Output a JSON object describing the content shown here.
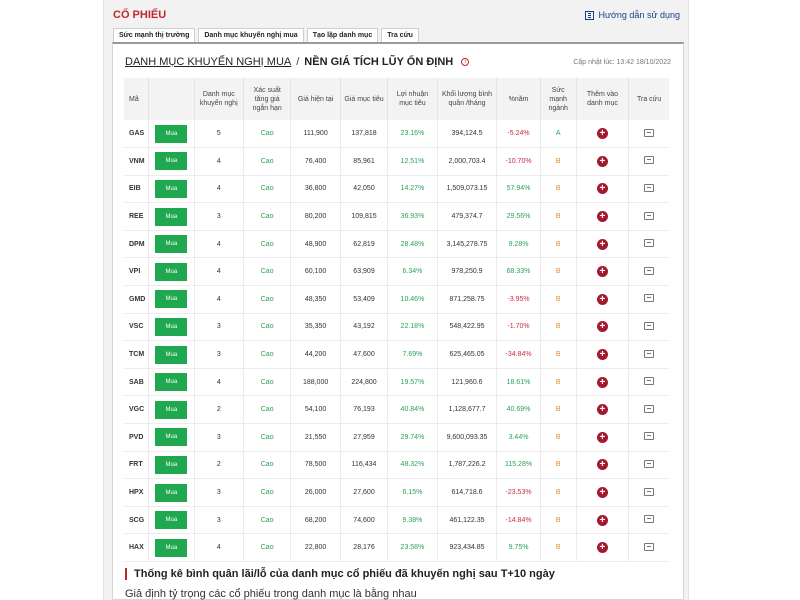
{
  "header": {
    "title": "CỔ PHIẾU",
    "guide_label": "Hướng dẫn sử dụng"
  },
  "tabs": [
    {
      "label": "Sức mạnh thị trường"
    },
    {
      "label": "Danh mục khuyến nghị mua"
    },
    {
      "label": "Tạo lập danh mục"
    },
    {
      "label": "Tra cứu"
    }
  ],
  "breadcrumb": {
    "parent": "DANH MỤC KHUYẾN NGHỊ MUA",
    "separator": "/",
    "current": "NỀN GIÁ TÍCH LŨY ỔN ĐỊNH",
    "info_icon": "i"
  },
  "updated": "Cập nhật lúc: 13:42 18/10/2022",
  "table": {
    "columns": [
      "Mã",
      "",
      "Danh mục khuyến nghị",
      "Xác suất tăng giá ngắn hạn",
      "Giá hiện tại",
      "Giá mục tiêu",
      "Lợi nhuận mục tiêu",
      "Khối lượng bình quân /tháng",
      "%năm",
      "Sức mạnh ngành",
      "Thêm vào danh mục",
      "Tra cứu"
    ],
    "buy_label": "Mua",
    "add_icon": "+",
    "rows": [
      {
        "code": "GAS",
        "count": "5",
        "prob": "Cao",
        "price": "111,900",
        "target": "137,818",
        "profit": "23.16%",
        "volume": "394,124.5",
        "year": "-5.24%",
        "year_color": "red",
        "strength": "A",
        "strength_color": "green-a"
      },
      {
        "code": "VNM",
        "count": "4",
        "prob": "Cao",
        "price": "76,400",
        "target": "85,961",
        "profit": "12.51%",
        "volume": "2,000,703.4",
        "year": "-10.70%",
        "year_color": "red",
        "strength": "B",
        "strength_color": "orange"
      },
      {
        "code": "EIB",
        "count": "4",
        "prob": "Cao",
        "price": "36,800",
        "target": "42,050",
        "profit": "14.27%",
        "volume": "1,509,073.15",
        "year": "57.94%",
        "year_color": "green",
        "strength": "B",
        "strength_color": "orange"
      },
      {
        "code": "REE",
        "count": "3",
        "prob": "Cao",
        "price": "80,200",
        "target": "109,815",
        "profit": "36.93%",
        "volume": "479,374.7",
        "year": "29.56%",
        "year_color": "green",
        "strength": "B",
        "strength_color": "orange"
      },
      {
        "code": "DPM",
        "count": "4",
        "prob": "Cao",
        "price": "48,900",
        "target": "62,819",
        "profit": "28.48%",
        "volume": "3,145,278.75",
        "year": "9.28%",
        "year_color": "green",
        "strength": "B",
        "strength_color": "orange"
      },
      {
        "code": "VPI",
        "count": "4",
        "prob": "Cao",
        "price": "60,100",
        "target": "63,909",
        "profit": "6.34%",
        "volume": "978,250.9",
        "year": "68.33%",
        "year_color": "green",
        "strength": "B",
        "strength_color": "orange"
      },
      {
        "code": "GMD",
        "count": "4",
        "prob": "Cao",
        "price": "48,350",
        "target": "53,409",
        "profit": "10.46%",
        "volume": "871,258.75",
        "year": "-3.95%",
        "year_color": "red",
        "strength": "B",
        "strength_color": "orange"
      },
      {
        "code": "VSC",
        "count": "3",
        "prob": "Cao",
        "price": "35,350",
        "target": "43,192",
        "profit": "22.18%",
        "volume": "548,422.95",
        "year": "-1.70%",
        "year_color": "red",
        "strength": "B",
        "strength_color": "orange"
      },
      {
        "code": "TCM",
        "count": "3",
        "prob": "Cao",
        "price": "44,200",
        "target": "47,600",
        "profit": "7.69%",
        "volume": "625,465.05",
        "year": "-34.84%",
        "year_color": "red",
        "strength": "B",
        "strength_color": "orange"
      },
      {
        "code": "SAB",
        "count": "4",
        "prob": "Cao",
        "price": "188,000",
        "target": "224,800",
        "profit": "19.57%",
        "volume": "121,960.6",
        "year": "18.61%",
        "year_color": "green",
        "strength": "B",
        "strength_color": "orange"
      },
      {
        "code": "VGC",
        "count": "2",
        "prob": "Cao",
        "price": "54,100",
        "target": "76,193",
        "profit": "40.84%",
        "volume": "1,128,677.7",
        "year": "40.69%",
        "year_color": "green",
        "strength": "B",
        "strength_color": "orange"
      },
      {
        "code": "PVD",
        "count": "3",
        "prob": "Cao",
        "price": "21,550",
        "target": "27,959",
        "profit": "29.74%",
        "volume": "9,600,093.35",
        "year": "3.44%",
        "year_color": "green",
        "strength": "B",
        "strength_color": "orange"
      },
      {
        "code": "FRT",
        "count": "2",
        "prob": "Cao",
        "price": "78,500",
        "target": "116,434",
        "profit": "48.32%",
        "volume": "1,787,226.2",
        "year": "115.28%",
        "year_color": "green",
        "strength": "B",
        "strength_color": "orange"
      },
      {
        "code": "HPX",
        "count": "3",
        "prob": "Cao",
        "price": "26,000",
        "target": "27,600",
        "profit": "6.15%",
        "volume": "614,718.6",
        "year": "-23.53%",
        "year_color": "red",
        "strength": "B",
        "strength_color": "orange"
      },
      {
        "code": "SCG",
        "count": "3",
        "prob": "Cao",
        "price": "68,200",
        "target": "74,600",
        "profit": "9.38%",
        "volume": "461,122.35",
        "year": "-14.84%",
        "year_color": "red",
        "strength": "B",
        "strength_color": "orange"
      },
      {
        "code": "HAX",
        "count": "4",
        "prob": "Cao",
        "price": "22,800",
        "target": "28,176",
        "profit": "23.58%",
        "volume": "923,434.85",
        "year": "9.75%",
        "year_color": "green",
        "strength": "B",
        "strength_color": "orange"
      }
    ]
  },
  "stats": {
    "title": "Thống kê bình quân lãi/lỗ của danh mục cổ phiếu đã khuyến nghị sau T+10 ngày",
    "subtitle": "Giả định tỷ trọng các cổ phiếu trong danh mục là bằng nhau"
  }
}
